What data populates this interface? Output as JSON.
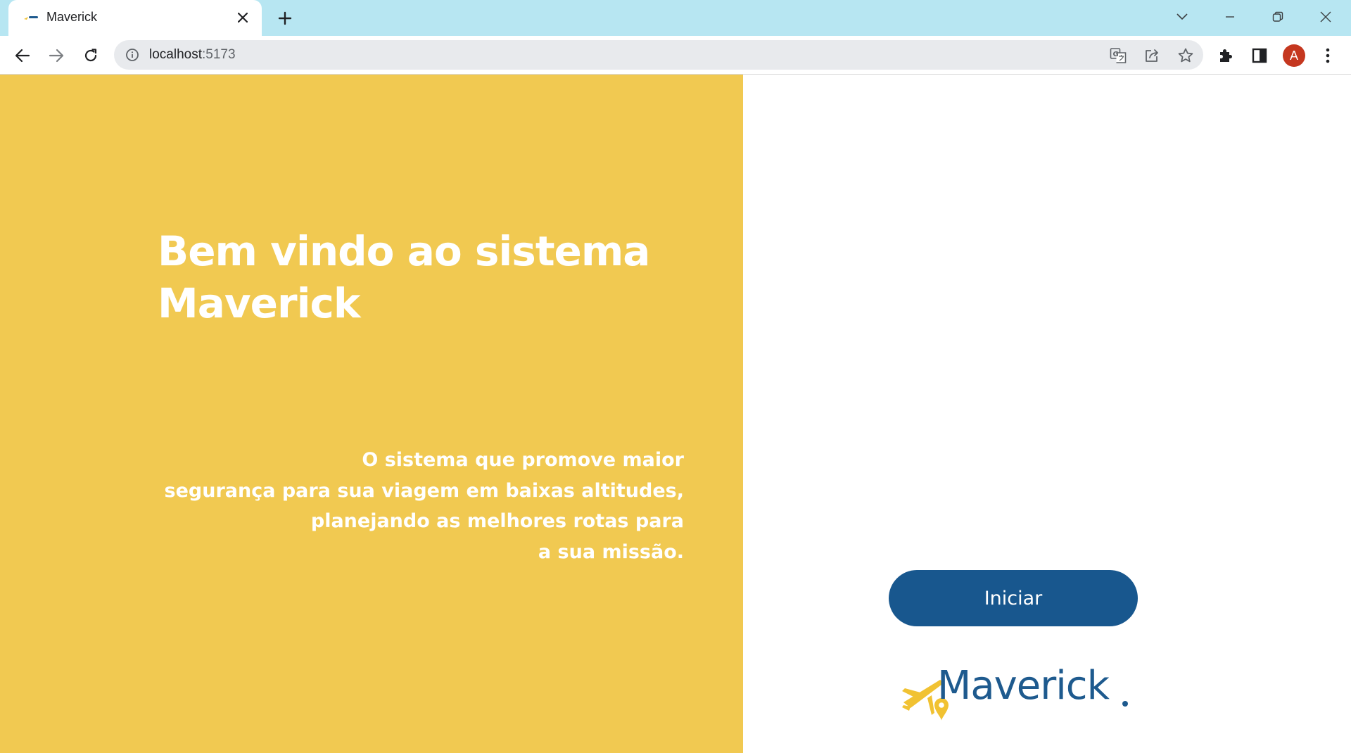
{
  "colors": {
    "tabbar_bg": "#b7e6f2",
    "left_panel": "#f1c951",
    "start_button": "#18578e",
    "logo_text": "#1e5a8e",
    "logo_plane": "#f1c232"
  },
  "browser": {
    "tab_title": "Maverick",
    "url_host": "localhost",
    "url_port": ":5173",
    "profile_initial": "A",
    "icons": {
      "favicon": "maverick-favicon",
      "tab_close": "close-icon",
      "new_tab": "plus-icon",
      "tab_search": "chevron-down-icon",
      "minimize": "minimize-icon",
      "restore": "restore-icon",
      "close_window": "close-icon",
      "back": "arrow-left-icon",
      "forward": "arrow-right-icon",
      "reload": "reload-icon",
      "site_info": "info-icon",
      "translate": "translate-icon",
      "share": "share-icon",
      "bookmark": "star-icon",
      "extensions": "puzzle-icon",
      "side_panel": "side-panel-icon",
      "menu": "kebab-menu-icon"
    }
  },
  "welcome": {
    "title": "Bem vindo ao sistema Maverick",
    "description_lines": [
      "O sistema que promove maior",
      "segurança para sua viagem em baixas altitudes,",
      "planejando as melhores rotas para",
      "a sua missão."
    ],
    "start_button_label": "Iniciar"
  },
  "logo": {
    "text": "Maverick",
    "icon": "plane-location-pin-icon"
  }
}
